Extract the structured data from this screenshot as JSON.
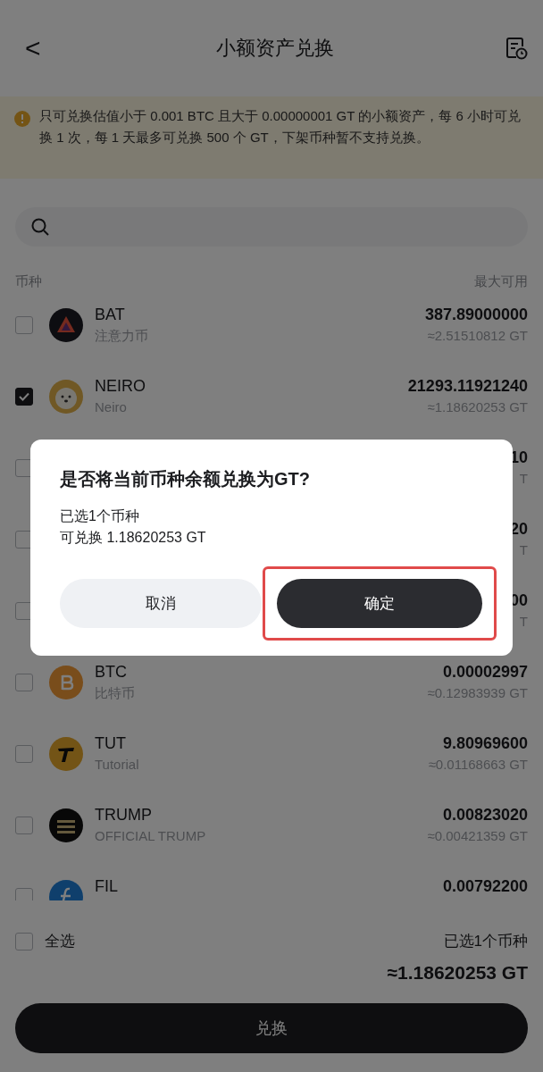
{
  "header": {
    "back": "<",
    "title": "小额资产兑换"
  },
  "notice": "只可兑换估值小于 0.001 BTC 且大于 0.00000001 GT 的小额资产，每 6 小时可兑换 1 次，每 1 天最多可兑换 500 个 GT，下架币种暂不支持兑换。",
  "columns": {
    "left": "币种",
    "right": "最大可用"
  },
  "coins": [
    {
      "kind": "bat",
      "symbol": "BAT",
      "name": "注意力币",
      "amount": "387.89000000",
      "value": "≈2.51510812 GT",
      "checked": false
    },
    {
      "kind": "neiro",
      "symbol": "NEIRO",
      "name": "Neiro",
      "amount": "21293.11921240",
      "value": "≈1.18620253 GT",
      "checked": true
    },
    {
      "kind": "hidden",
      "amount": "10",
      "value": "T",
      "checked": false
    },
    {
      "kind": "hidden",
      "amount": "20",
      "value": "T",
      "checked": false
    },
    {
      "kind": "hidden",
      "amount": "00",
      "value": "T",
      "checked": false
    },
    {
      "kind": "btc",
      "symbol": "BTC",
      "name": "比特币",
      "amount": "0.00002997",
      "value": "≈0.12983939 GT",
      "checked": false
    },
    {
      "kind": "tut",
      "symbol": "TUT",
      "name": "Tutorial",
      "amount": "9.80969600",
      "value": "≈0.01168663 GT",
      "checked": false
    },
    {
      "kind": "trump",
      "symbol": "TRUMP",
      "name": "OFFICIAL TRUMP",
      "amount": "0.00823020",
      "value": "≈0.00421359 GT",
      "checked": false
    },
    {
      "kind": "fil",
      "symbol": "FIL",
      "amount": "0.00792200",
      "checked": false
    }
  ],
  "footer": {
    "select_all": {
      "label": "全选",
      "checked": false
    },
    "selected_count": "已选1个币种",
    "total": "≈1.18620253 GT",
    "button": "兑换"
  },
  "dialog": {
    "title": "是否将当前币种余额兑换为GT?",
    "lines": [
      "已选1个币种",
      "可兑换 1.18620253 GT"
    ],
    "cancel": "取消",
    "confirm": "确定",
    "confirm_highlighted": true
  }
}
